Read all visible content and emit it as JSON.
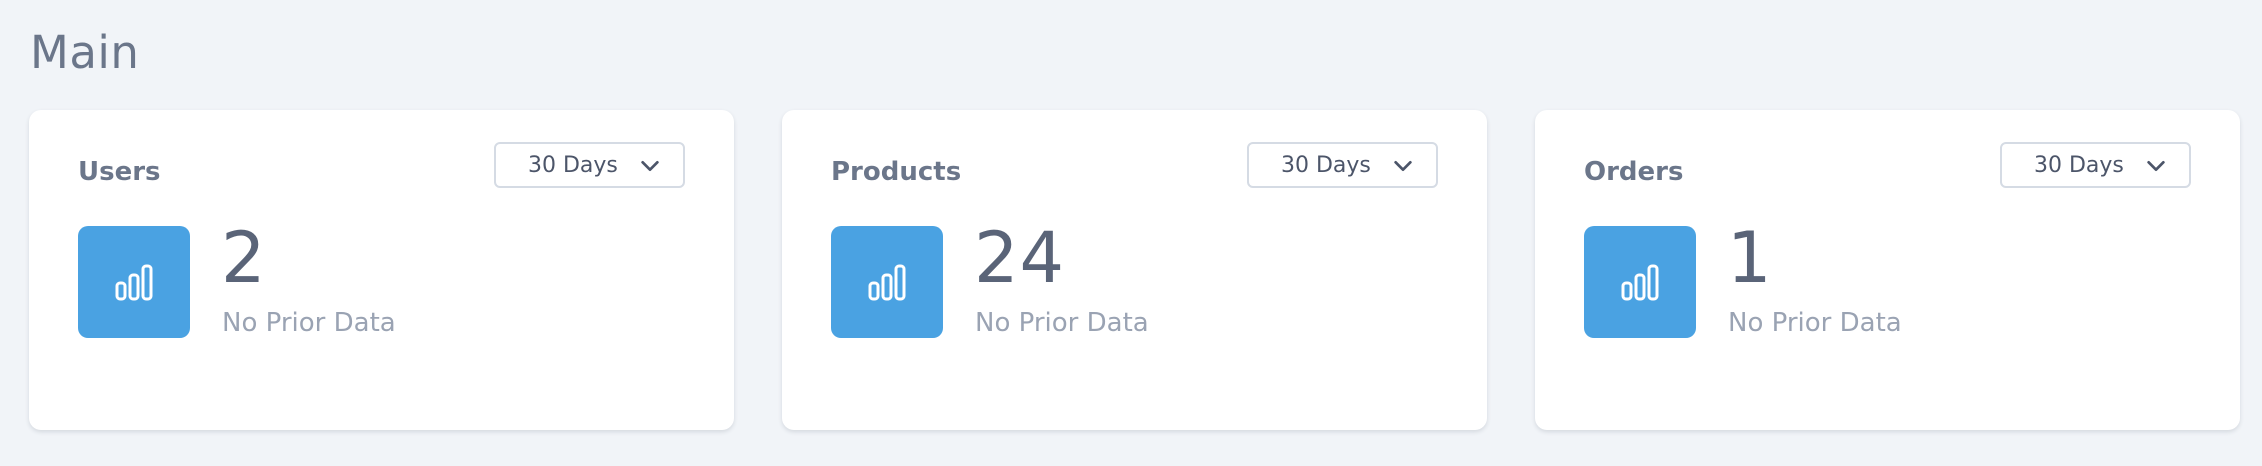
{
  "page": {
    "title": "Main"
  },
  "cards": [
    {
      "title": "Users",
      "range": "30 Days",
      "value": "2",
      "note": "No Prior Data",
      "icon": "bar-chart-icon"
    },
    {
      "title": "Products",
      "range": "30 Days",
      "value": "24",
      "note": "No Prior Data",
      "icon": "bar-chart-icon"
    },
    {
      "title": "Orders",
      "range": "30 Days",
      "value": "1",
      "note": "No Prior Data",
      "icon": "bar-chart-icon"
    }
  ],
  "colors": {
    "background": "#f1f4f8",
    "card": "#ffffff",
    "accent": "#4aa2e2",
    "title_text": "#6b768a",
    "muted_text": "#9aa3b3"
  }
}
